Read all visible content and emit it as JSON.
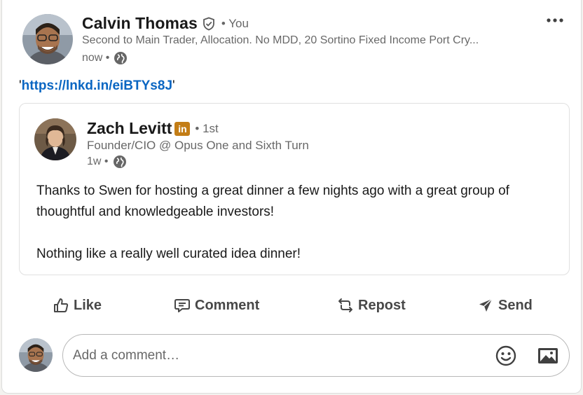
{
  "author": {
    "name": "Calvin Thomas",
    "relation": "• You",
    "headline": "Second to Main Trader, Allocation. No MDD, 20 Sortino Fixed Income Port Cry...",
    "time": "now •",
    "avatar_icon": "person-avatar"
  },
  "post": {
    "quote_open": "'",
    "link_text": "https://lnkd.in/eiBTYs8J",
    "quote_close": "'"
  },
  "shared_post": {
    "author_name": "Zach Levitt",
    "badge_text": "in",
    "relation": "• 1st",
    "headline": "Founder/CIO @ Opus One and Sixth Turn",
    "time": "1w •",
    "paragraphs": [
      "Thanks to Swen for hosting a great dinner a few nights ago with a great group of thoughtful and knowledgeable investors!",
      "Nothing like a really well curated idea dinner!"
    ]
  },
  "actions": {
    "like": "Like",
    "comment": "Comment",
    "repost": "Repost",
    "send": "Send"
  },
  "comment_box": {
    "placeholder": "Add a comment…"
  },
  "colors": {
    "link": "#0a66c2",
    "badge": "#c37d16",
    "muted_text": "rgba(0,0,0,0.6)"
  }
}
